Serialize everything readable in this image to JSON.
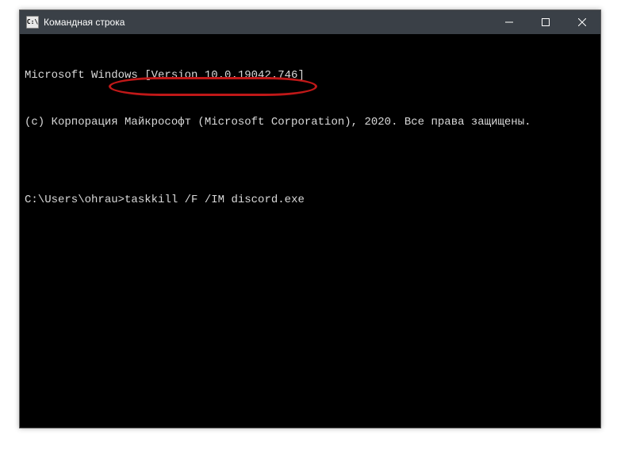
{
  "window": {
    "title": "Командная строка"
  },
  "console": {
    "line1": "Microsoft Windows [Version 10.0.19042.746]",
    "line2": "(c) Корпорация Майкрософт (Microsoft Corporation), 2020. Все права защищены.",
    "blank": "",
    "prompt": "C:\\Users\\ohrau>",
    "command": "taskkill /F /IM discord.exe"
  },
  "highlight": {
    "color": "#c01818"
  }
}
